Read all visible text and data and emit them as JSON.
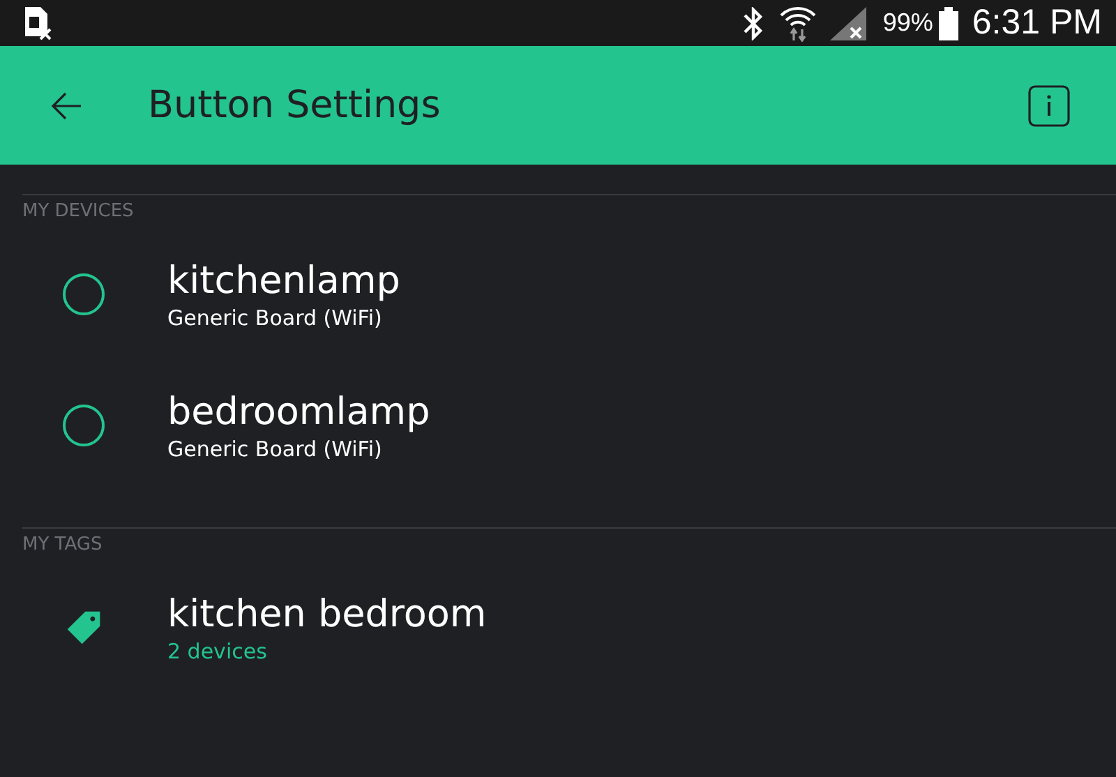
{
  "status_bar": {
    "battery": "99%",
    "time": "6:31 PM"
  },
  "app_bar": {
    "title": "Button Settings"
  },
  "sections": [
    {
      "heading": "MY DEVICES",
      "items": [
        {
          "kind": "device",
          "name": "kitchenlamp",
          "detail": "Generic Board (WiFi)",
          "selected": false
        },
        {
          "kind": "device",
          "name": "bedroomlamp",
          "detail": "Generic Board (WiFi)",
          "selected": false
        }
      ]
    },
    {
      "heading": "MY TAGS",
      "items": [
        {
          "kind": "tag",
          "name": "kitchen bedroom",
          "detail": "2 devices",
          "selected": false
        }
      ]
    }
  ]
}
